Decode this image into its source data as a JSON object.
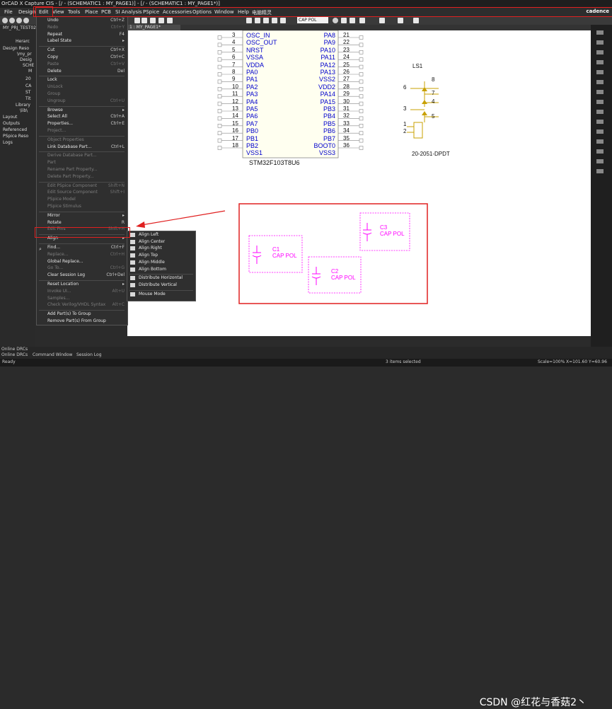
{
  "window": {
    "title": "OrCAD X Capture CIS - [/ - (SCHEMATIC1 : MY_PAGE1)] - [/ - (SCHEMATIC1 : MY_PAGE1*)]"
  },
  "menubar": {
    "items": [
      "File",
      "Design",
      "Edit",
      "View",
      "Tools",
      "Place",
      "PCB",
      "SI Analysis",
      "PSpice",
      "Accessories",
      "Options",
      "Window",
      "Help",
      "电脑精灵"
    ],
    "brand": "cadence"
  },
  "toolbar": {
    "part_field": "CAP POL"
  },
  "tabs": {
    "left": "MY_PRJ_TEST021",
    "page": "1 : MY_PAGE1*"
  },
  "tree": [
    "Herarc",
    "Design Reso",
    "\\my_pr",
    "Desig",
    "SCHE",
    "M",
    "20",
    "CA",
    "ST",
    "Tit",
    "Library",
    "\\lib\\",
    "Layout",
    "Outputs",
    "Referenced",
    "PSpice Reso",
    "Logs"
  ],
  "edit_menu": [
    {
      "label": "Undo",
      "shortcut": "Ctrl+Z",
      "disabled": false
    },
    {
      "label": "Redo",
      "shortcut": "Ctrl+Y",
      "disabled": true
    },
    {
      "label": "Repeat",
      "shortcut": "F4",
      "disabled": false
    },
    {
      "label": "Label State",
      "shortcut": "▸",
      "disabled": false
    },
    {
      "label": "Cut",
      "shortcut": "Ctrl+X",
      "disabled": false
    },
    {
      "label": "Copy",
      "shortcut": "Ctrl+C",
      "disabled": false
    },
    {
      "label": "Paste",
      "shortcut": "Ctrl+V",
      "disabled": true
    },
    {
      "label": "Delete",
      "shortcut": "Del",
      "disabled": false
    },
    {
      "label": "Lock",
      "shortcut": "",
      "disabled": false
    },
    {
      "label": "UnLock",
      "shortcut": "",
      "disabled": true
    },
    {
      "label": "Group",
      "shortcut": "",
      "disabled": true
    },
    {
      "label": "Ungroup",
      "shortcut": "Ctrl+U",
      "disabled": true
    },
    {
      "label": "Browse",
      "shortcut": "▸",
      "disabled": false
    },
    {
      "label": "Select All",
      "shortcut": "Ctrl+A",
      "disabled": false
    },
    {
      "label": "Properties...",
      "shortcut": "Ctrl+E",
      "disabled": false
    },
    {
      "label": "Project...",
      "shortcut": "",
      "disabled": true
    },
    {
      "label": "Object Properties",
      "shortcut": "",
      "disabled": true
    },
    {
      "label": "Link Database Part...",
      "shortcut": "Ctrl+L",
      "disabled": false
    },
    {
      "label": "Derive Database Part...",
      "shortcut": "",
      "disabled": true
    },
    {
      "label": "Part",
      "shortcut": "",
      "disabled": true
    },
    {
      "label": "Rename Part Property...",
      "shortcut": "",
      "disabled": true
    },
    {
      "label": "Delete Part Property...",
      "shortcut": "",
      "disabled": true
    },
    {
      "label": "Edit PSpice Component",
      "shortcut": "Shift+N",
      "disabled": true
    },
    {
      "label": "Edit Source Component",
      "shortcut": "Shift+I",
      "disabled": true
    },
    {
      "label": "PSpice Model",
      "shortcut": "",
      "disabled": true
    },
    {
      "label": "PSpice Stimulus",
      "shortcut": "",
      "disabled": true
    },
    {
      "label": "Mirror",
      "shortcut": "▸",
      "disabled": false
    },
    {
      "label": "Rotate",
      "shortcut": "R",
      "disabled": false
    },
    {
      "label": "Edit Pins",
      "shortcut": "Shift+H",
      "disabled": true
    },
    {
      "label": "Align",
      "shortcut": "▸",
      "disabled": false
    },
    {
      "label": "Find...",
      "shortcut": "Ctrl+F",
      "disabled": false
    },
    {
      "label": "Replace...",
      "shortcut": "Ctrl+H",
      "disabled": true
    },
    {
      "label": "Global Replace...",
      "shortcut": "",
      "disabled": false
    },
    {
      "label": "Go To...",
      "shortcut": "Ctrl+G",
      "disabled": true
    },
    {
      "label": "Clear Session Log",
      "shortcut": "Ctrl+Del",
      "disabled": false
    },
    {
      "label": "Reset Location",
      "shortcut": "▸",
      "disabled": false
    },
    {
      "label": "Invoke UI...",
      "shortcut": "Alt+U",
      "disabled": true
    },
    {
      "label": "Samples...",
      "shortcut": "",
      "disabled": true
    },
    {
      "label": "Check Verilog/VHDL Syntax",
      "shortcut": "Alt+C",
      "disabled": true
    },
    {
      "label": "Add Part(s) To Group",
      "shortcut": "",
      "disabled": false
    },
    {
      "label": "Remove Part(s) From Group",
      "shortcut": "",
      "disabled": false
    }
  ],
  "align_submenu": [
    "Align Left",
    "Align Center",
    "Align Right",
    "Align Top",
    "Align Middle",
    "Align Bottom",
    "Distribute Horizontal",
    "Distribute Vertical",
    "Mouse Mode"
  ],
  "mcu": {
    "name": "STM32F103T8U6",
    "left_pins": [
      {
        "num": "3",
        "name": "OSC_IN"
      },
      {
        "num": "4",
        "name": "OSC_OUT"
      },
      {
        "num": "5",
        "name": "NRST"
      },
      {
        "num": "6",
        "name": "VSSA"
      },
      {
        "num": "7",
        "name": "VDDA"
      },
      {
        "num": "8",
        "name": "PA0"
      },
      {
        "num": "9",
        "name": "PA1"
      },
      {
        "num": "10",
        "name": "PA2"
      },
      {
        "num": "11",
        "name": "PA3"
      },
      {
        "num": "12",
        "name": "PA4"
      },
      {
        "num": "13",
        "name": "PA5"
      },
      {
        "num": "14",
        "name": "PA6"
      },
      {
        "num": "15",
        "name": "PA7"
      },
      {
        "num": "16",
        "name": "PB0"
      },
      {
        "num": "17",
        "name": "PB1"
      },
      {
        "num": "18",
        "name": "PB2"
      },
      {
        "num": "",
        "name": "VSS1"
      }
    ],
    "right_pins": [
      {
        "num": "21",
        "name": "PA8"
      },
      {
        "num": "22",
        "name": "PA9"
      },
      {
        "num": "23",
        "name": "PA10"
      },
      {
        "num": "24",
        "name": "PA11"
      },
      {
        "num": "25",
        "name": "PA12"
      },
      {
        "num": "26",
        "name": "PA13"
      },
      {
        "num": "27",
        "name": "VSS2"
      },
      {
        "num": "28",
        "name": "VDD2"
      },
      {
        "num": "29",
        "name": "PA14"
      },
      {
        "num": "30",
        "name": "PA15"
      },
      {
        "num": "31",
        "name": "PB3"
      },
      {
        "num": "32",
        "name": "PB4"
      },
      {
        "num": "33",
        "name": "PB5"
      },
      {
        "num": "34",
        "name": "PB6"
      },
      {
        "num": "35",
        "name": "PB7"
      },
      {
        "num": "36",
        "name": "BOOT0"
      },
      {
        "num": "",
        "name": "VSS3"
      }
    ]
  },
  "switch": {
    "ref": "LS1",
    "part": "20-2051-DPDT",
    "pins": [
      "8",
      "6",
      "7",
      "4",
      "3",
      "5",
      "1",
      "2"
    ]
  },
  "caps": [
    {
      "ref": "C1",
      "value": "CAP POL"
    },
    {
      "ref": "C2",
      "value": "CAP POL"
    },
    {
      "ref": "C3",
      "value": "CAP POL"
    }
  ],
  "bottom": {
    "tab1": "Online DRCs",
    "tab2": "Online DRCs",
    "tab3": "Command Window",
    "tab4": "Session Log"
  },
  "status": {
    "left": "Ready",
    "center": "3 items selected",
    "zoom": "Scale=100%",
    "coords": "X=101.60  Y=60.96"
  },
  "watermark": "CSDN @红花与香菇2丶",
  "colors": {
    "highlight_red": "#e02020",
    "pin_blue": "#0000cc",
    "selection_magenta": "#ff00ff",
    "switch_orange": "#c8a000"
  }
}
